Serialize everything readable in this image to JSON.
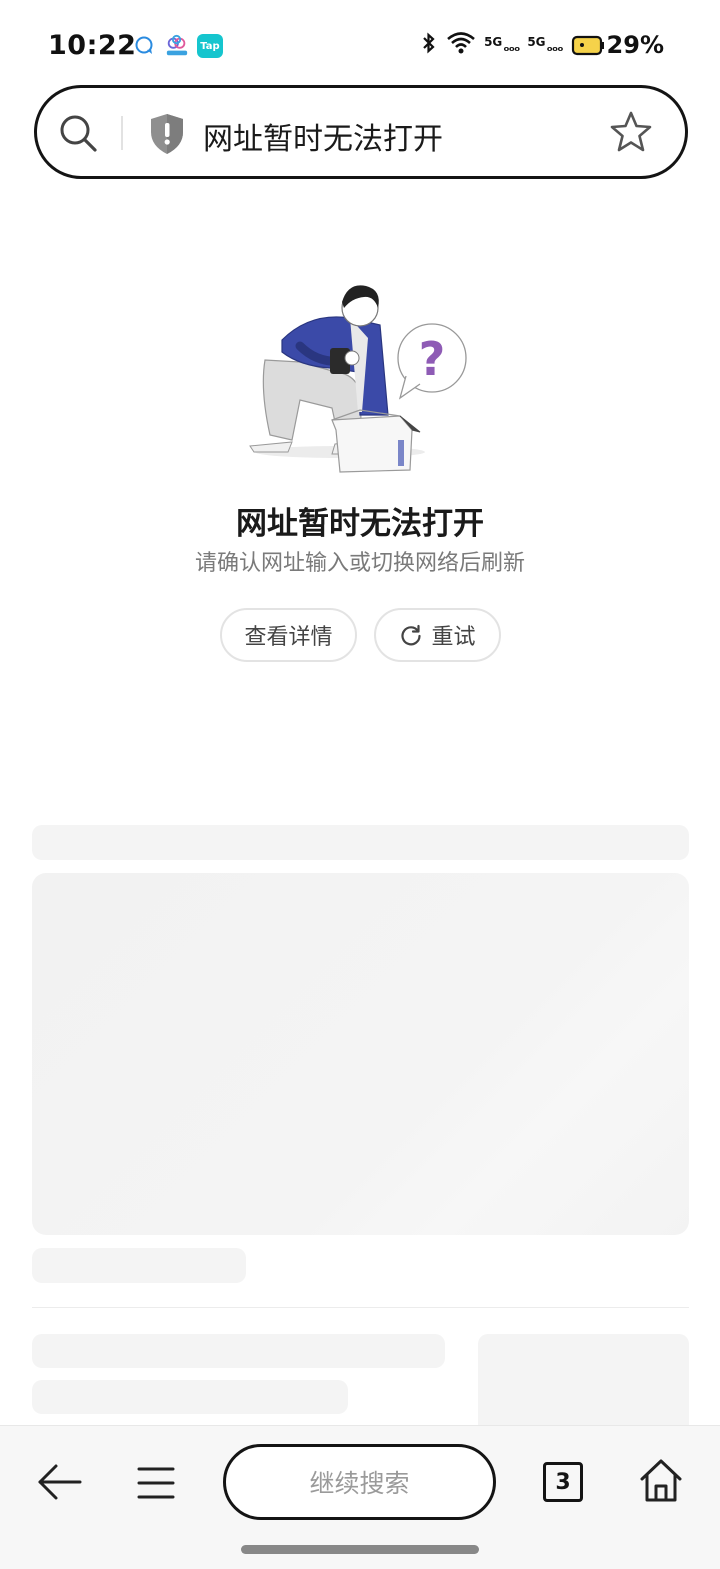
{
  "status_bar": {
    "time": "10:22",
    "notification_icons": [
      "chat-icon",
      "cloud-app-icon",
      "tap-app-icon"
    ],
    "tap_app_label": "Tap",
    "bluetooth": "bluetooth-icon",
    "signal_1": "5G",
    "signal_2": "5G",
    "battery_percent": "29%"
  },
  "address_bar": {
    "text": "网址暂时无法打开"
  },
  "error": {
    "title": "网址暂时无法打开",
    "description": "请确认网址输入或切换网络后刷新",
    "details_button": "查看详情",
    "retry_button": "重试"
  },
  "bottom_bar": {
    "search_label": "继续搜索",
    "tab_count": "3"
  },
  "colors": {
    "border_dark": "#141414",
    "illustration_blue": "#3b4aa8",
    "question_purple": "#8e5bb5",
    "skeleton": "#f4f4f4",
    "bottom_bar_bg": "#f7f7f7"
  }
}
